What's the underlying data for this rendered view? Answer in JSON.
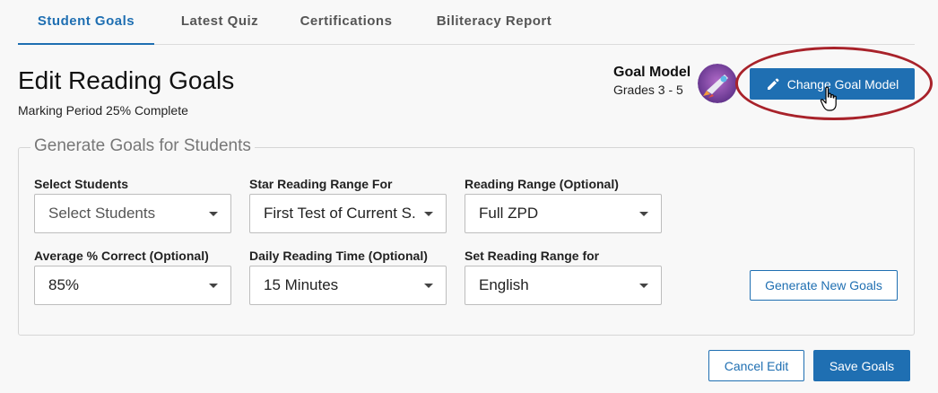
{
  "tabs": [
    {
      "label": "Student Goals",
      "active": true
    },
    {
      "label": "Latest Quiz",
      "active": false
    },
    {
      "label": "Certifications",
      "active": false
    },
    {
      "label": "Biliteracy Report",
      "active": false
    }
  ],
  "header": {
    "title": "Edit Reading Goals",
    "marking_period": "Marking Period 25% Complete",
    "goal_model_title": "Goal Model",
    "goal_model_grades": "Grades 3 - 5",
    "avatar_icon": "rocket-avatar-icon",
    "change_goal_model_label": "Change Goal Model"
  },
  "generate": {
    "legend": "Generate Goals for Students",
    "fields": [
      {
        "label": "Select Students",
        "value": "Select Students",
        "is_placeholder": true
      },
      {
        "label": "Star Reading Range For",
        "value": "First Test of Current S..."
      },
      {
        "label": "Reading Range (Optional)",
        "value": "Full ZPD"
      },
      {
        "label": "Average % Correct (Optional)",
        "value": "85%"
      },
      {
        "label": "Daily Reading Time (Optional)",
        "value": "15 Minutes"
      },
      {
        "label": "Set Reading Range for",
        "value": "English"
      }
    ],
    "generate_button_label": "Generate New Goals"
  },
  "footer": {
    "cancel_label": "Cancel Edit",
    "save_label": "Save Goals"
  },
  "colors": {
    "accent": "#1f6fb2",
    "highlight": "#a8222a"
  }
}
